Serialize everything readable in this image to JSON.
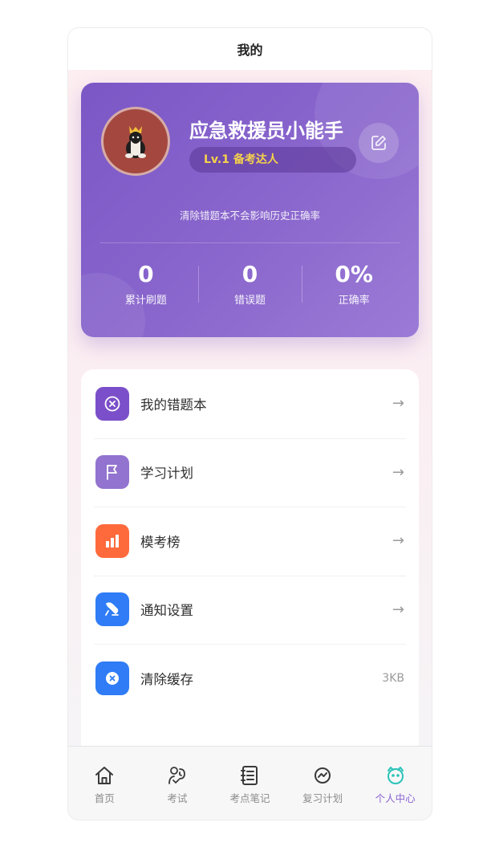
{
  "page": {
    "title": "我的"
  },
  "profile": {
    "name": "应急救援员小能手",
    "level": "Lv.1 备考达人",
    "hint": "清除错题本不会影响历史正确率",
    "avatar_icon": "cat-avatar-icon",
    "edit_icon": "edit-icon",
    "stats": [
      {
        "value": "0",
        "label": "累计刷题"
      },
      {
        "value": "0",
        "label": "错误题"
      },
      {
        "value": "0%",
        "label": "正确率"
      }
    ]
  },
  "menu": [
    {
      "label": "我的错题本",
      "icon": "x-circle-icon",
      "color": "#7b4fc9",
      "trailing": "→"
    },
    {
      "label": "学习计划",
      "icon": "flag-icon",
      "color": "#9273cf",
      "trailing": "→"
    },
    {
      "label": "模考榜",
      "icon": "bar-chart-icon",
      "color": "#ff6a3d",
      "trailing": "→"
    },
    {
      "label": "通知设置",
      "icon": "bell-icon",
      "color": "#2f7cf6",
      "trailing": "→"
    },
    {
      "label": "清除缓存",
      "icon": "clear-icon",
      "color": "#2f7cf6",
      "trailing": "3KB"
    }
  ],
  "tabs": [
    {
      "label": "首页",
      "icon": "home-icon"
    },
    {
      "label": "考试",
      "icon": "exam-icon"
    },
    {
      "label": "考点笔记",
      "icon": "notebook-icon"
    },
    {
      "label": "复习计划",
      "icon": "review-icon"
    },
    {
      "label": "个人中心",
      "icon": "profile-icon",
      "active": true
    }
  ],
  "colors": {
    "accent": "#8a63d2",
    "level_text": "#f6d24a"
  }
}
